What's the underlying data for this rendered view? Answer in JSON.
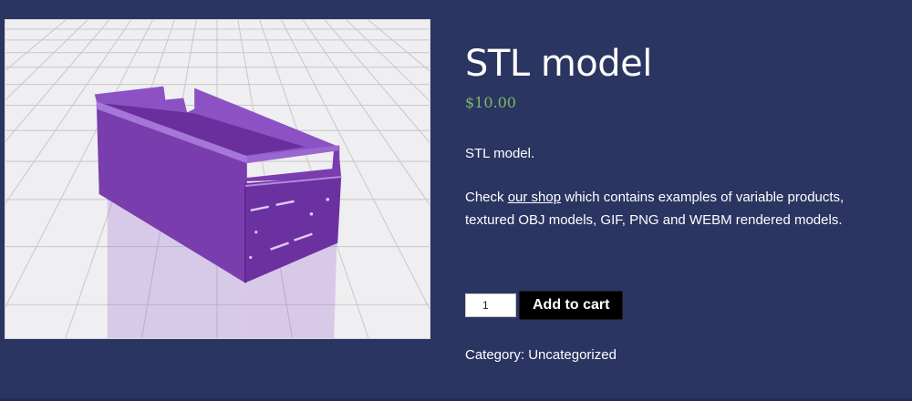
{
  "product": {
    "title": "STL model",
    "price": "$10.00",
    "short_description": "STL model.",
    "blurb": {
      "before_link": "Check ",
      "link_text": "our shop",
      "after_link": " which contains examples of variable products, textured OBJ models, GIF, PNG and WEBM rendered models."
    },
    "quantity": "1",
    "add_to_cart_label": "Add to cart",
    "category_label": "Category:",
    "category_value": "Uncategorized"
  },
  "viewer": {
    "floor_color": "#efeff1",
    "grid_color": "#c7c7cb",
    "model_color": "#7a3dae"
  }
}
